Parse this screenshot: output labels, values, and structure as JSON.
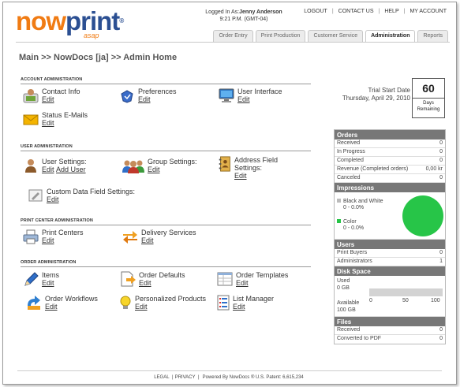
{
  "logo": {
    "now": "now",
    "print": "print",
    "tm": "®",
    "sub": "asap"
  },
  "login": {
    "prefix": "Logged In As:",
    "user": "Jenny Anderson",
    "time": "9:21 P.M. (GMT-04)"
  },
  "toplinks": [
    "LOGOUT",
    "CONTACT US",
    "HELP",
    "MY ACCOUNT"
  ],
  "tabs": [
    "Order Entry",
    "Print Production",
    "Customer Service",
    "Administration",
    "Reports"
  ],
  "active_tab": "Administration",
  "breadcrumb": "Main >> NowDocs [ja] >> Admin Home",
  "sections": {
    "account": "ACCOUNT ADMINISTRATION",
    "user": "USER ADMINISTRATION",
    "print_center": "PRINT CENTER ADMINISTRATION",
    "order": "ORDER ADMINISTRATION"
  },
  "items": {
    "contact_info": {
      "label": "Contact Info",
      "edit": "Edit"
    },
    "preferences": {
      "label": "Preferences",
      "edit": "Edit"
    },
    "user_interface": {
      "label": "User Interface",
      "edit": "Edit"
    },
    "status_emails": {
      "label": "Status E-Mails",
      "edit": "Edit"
    },
    "user_settings": {
      "label": "User Settings:",
      "edit": "Edit",
      "add": "Add User"
    },
    "group_settings": {
      "label": "Group Settings:",
      "edit": "Edit"
    },
    "address_field": {
      "label": "Address Field Settings:",
      "edit": "Edit"
    },
    "custom_data": {
      "label": "Custom Data Field Settings:",
      "edit": "Edit"
    },
    "print_centers": {
      "label": "Print Centers",
      "edit": "Edit"
    },
    "delivery": {
      "label": "Delivery Services",
      "edit": "Edit"
    },
    "items": {
      "label": "Items",
      "edit": "Edit"
    },
    "order_defaults": {
      "label": "Order Defaults",
      "edit": "Edit"
    },
    "order_templates": {
      "label": "Order Templates",
      "edit": "Edit"
    },
    "order_workflows": {
      "label": "Order Workflows",
      "edit": "Edit"
    },
    "personalized": {
      "label": "Personalized Products",
      "edit": "Edit"
    },
    "list_manager": {
      "label": "List Manager",
      "edit": "Edit"
    }
  },
  "trial": {
    "label": "Trial Start Date",
    "date": "Thursday, April 29, 2010",
    "days": "60",
    "days_label": "Days Remaining"
  },
  "orders": {
    "title": "Orders",
    "rows": [
      {
        "label": "Received",
        "value": "0"
      },
      {
        "label": "In Progress",
        "value": "0"
      },
      {
        "label": "Completed",
        "value": "0"
      },
      {
        "label": "Revenue (Completed orders)",
        "value": "0,00 kr"
      },
      {
        "label": "Canceled",
        "value": "0"
      }
    ]
  },
  "impressions": {
    "title": "Impressions",
    "bw_label": "Black and White",
    "bw_value": "0 - 0.0%",
    "color_label": "Color",
    "color_value": "0 - 0.0%",
    "bw_color": "#bbbbbb",
    "color_color": "#27c548"
  },
  "users": {
    "title": "Users",
    "rows": [
      {
        "label": "Print Buyers",
        "value": "0"
      },
      {
        "label": "Administrators",
        "value": "1"
      }
    ]
  },
  "disk": {
    "title": "Disk Space",
    "used_label": "Used",
    "used_value": "0 GB",
    "avail_label": "Available",
    "avail_value": "100 GB",
    "ticks": [
      "0",
      "50",
      "100"
    ]
  },
  "files": {
    "title": "Files",
    "rows": [
      {
        "label": "Received",
        "value": "0"
      },
      {
        "label": "Converted to PDF",
        "value": "0"
      }
    ]
  },
  "footer": {
    "legal": "LEGAL",
    "privacy": "PRIVACY",
    "powered": "Powered By NowDocs ® U.S. Patent: 6,615,234"
  }
}
